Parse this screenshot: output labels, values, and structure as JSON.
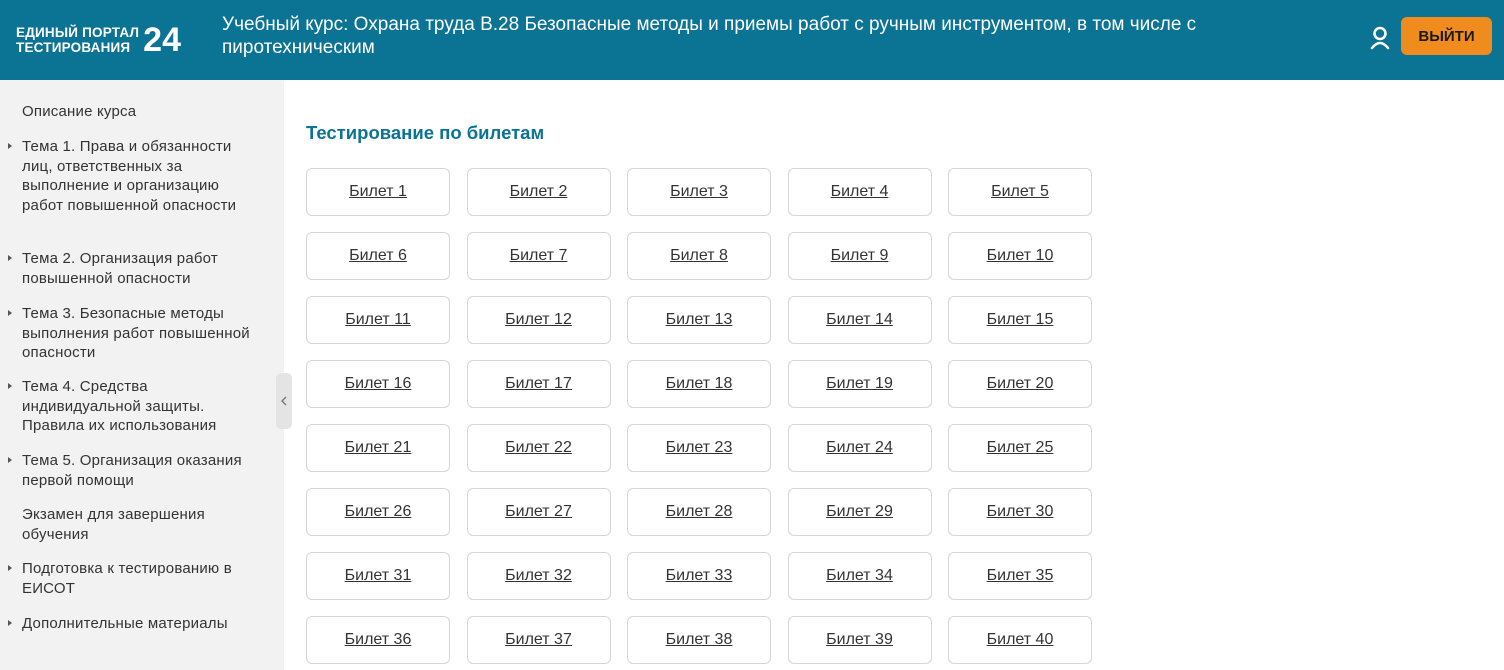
{
  "header": {
    "logo_line1": "ЕДИНЫЙ ПОРТАЛ",
    "logo_line2": "ТЕСТИРОВАНИЯ",
    "logo_number": "24",
    "course_title": "Учебный курс: Охрана труда В.28 Безопасные методы и приемы работ с ручным инструментом, в том числе с пиротехническим",
    "user_icon": "user-icon",
    "logout_label": "ВЫЙТИ",
    "bg_color": "#0b7393",
    "accent_color": "#f08c1e"
  },
  "sidebar": {
    "items": [
      {
        "label": "Описание курса",
        "arrow": false
      },
      {
        "label": "Тема 1. Права и обязанности лиц, ответственных за выполнение и организацию работ повышенной опасности",
        "arrow": true
      },
      {
        "label": "Тема 2. Организация работ повышенной опасности",
        "arrow": true
      },
      {
        "label": "Тема 3. Безопасные методы выполнения работ повышенной опасности",
        "arrow": true
      },
      {
        "label": "Тема 4. Средства индивидуальной защиты. Правила их использования",
        "arrow": true
      },
      {
        "label": "Тема 5. Организация оказания первой помощи",
        "arrow": true
      },
      {
        "label": "Экзамен для завершения обучения",
        "arrow": false
      },
      {
        "label": "Подготовка к тестированию в ЕИСОТ",
        "arrow": true
      },
      {
        "label": "Дополнительные материалы",
        "arrow": true
      }
    ]
  },
  "main": {
    "section_title": "Тестирование по билетам",
    "tickets": [
      "Билет 1",
      "Билет 2",
      "Билет 3",
      "Билет 4",
      "Билет 5",
      "Билет 6",
      "Билет 7",
      "Билет 8",
      "Билет 9",
      "Билет 10",
      "Билет 11",
      "Билет 12",
      "Билет 13",
      "Билет 14",
      "Билет 15",
      "Билет 16",
      "Билет 17",
      "Билет 18",
      "Билет 19",
      "Билет 20",
      "Билет 21",
      "Билет 22",
      "Билет 23",
      "Билет 24",
      "Билет 25",
      "Билет 26",
      "Билет 27",
      "Билет 28",
      "Билет 29",
      "Билет 30",
      "Билет 31",
      "Билет 32",
      "Билет 33",
      "Билет 34",
      "Билет 35",
      "Билет 36",
      "Билет 37",
      "Билет 38",
      "Билет 39",
      "Билет 40"
    ]
  }
}
